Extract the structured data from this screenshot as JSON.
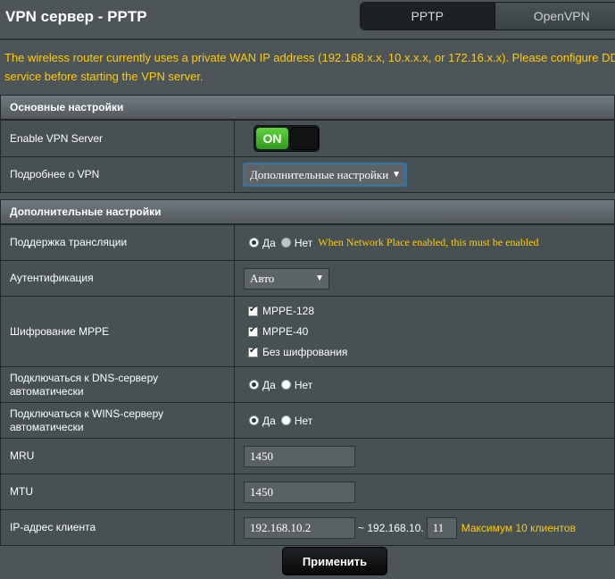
{
  "header": {
    "title": "VPN сервер - PPTP"
  },
  "tabs": [
    {
      "label": "PPTP",
      "active": true
    },
    {
      "label": "OpenVPN",
      "active": false
    }
  ],
  "notice": {
    "line1": "The wireless router currently uses a private WAN IP address (192.168.x.x, 10.x.x.x, or 172.16.x.x). Please configure DDNS",
    "line2": "service before starting the VPN server."
  },
  "basic": {
    "heading": "Основные настройки",
    "enable_vpn": {
      "label": "Enable VPN Server",
      "state": "ON"
    },
    "more_vpn": {
      "label": "Подробнее о VPN",
      "value": "Дополнительные настройки"
    }
  },
  "advanced": {
    "heading": "Дополнительные настройки",
    "broadcast": {
      "label": "Поддержка трансляции",
      "yes": "Да",
      "no": "Нет",
      "hint": "When Network Place enabled, this must be enabled"
    },
    "auth": {
      "label": "Аутентификация",
      "value": "Авто"
    },
    "mppe": {
      "label": "Шифрование MPPE",
      "options": [
        "MPPE-128",
        "MPPE-40",
        "Без шифрования"
      ]
    },
    "dns": {
      "label_line1": "Подключаться к DNS-серверу",
      "label_line2": "автоматически",
      "yes": "Да",
      "no": "Нет"
    },
    "wins": {
      "label_line1": "Подключаться к WINS-серверу",
      "label_line2": "автоматически",
      "yes": "Да",
      "no": "Нет"
    },
    "mru": {
      "label": "MRU",
      "value": "1450"
    },
    "mtu": {
      "label": "MTU",
      "value": "1450"
    },
    "client_ip": {
      "label": "IP-адрес клиента",
      "start": "192.168.10.2",
      "separator": "~ 192.168.10.",
      "end": "11",
      "max": "Максимум 10 клиентов"
    }
  },
  "apply_label": "Применить",
  "colors": {
    "accent_yellow": "#ffcc00",
    "toggle_green": "#3cb82a",
    "background": "#4d5558"
  }
}
